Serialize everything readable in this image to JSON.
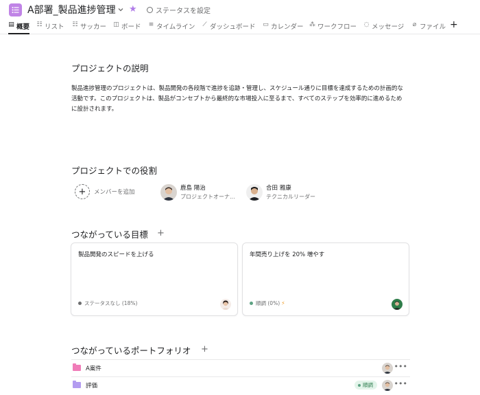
{
  "header": {
    "title": "A部署_製品進捗管理",
    "status_label": "ステータスを設定"
  },
  "tabs": [
    {
      "label": "概要",
      "icon": "clipboard-icon",
      "active": true
    },
    {
      "label": "リスト",
      "icon": "list-icon"
    },
    {
      "label": "サッカー",
      "icon": "list-icon"
    },
    {
      "label": "ボード",
      "icon": "board-icon"
    },
    {
      "label": "タイムライン",
      "icon": "timeline-icon"
    },
    {
      "label": "ダッシュボード",
      "icon": "dashboard-icon"
    },
    {
      "label": "カレンダー",
      "icon": "calendar-icon"
    },
    {
      "label": "ワークフロー",
      "icon": "workflow-icon"
    },
    {
      "label": "メッセージ",
      "icon": "message-icon"
    },
    {
      "label": "ファイル",
      "icon": "paperclip-icon"
    }
  ],
  "description": {
    "heading": "プロジェクトの説明",
    "text": "製品進捗管理のプロジェクトは、製品開発の各段階で進捗を追跡・管理し、スケジュール通りに目標を達成するための計画的な活動です。このプロジェクトは、製品がコンセプトから最終的な市場投入に至るまで、すべてのステップを効率的に進めるために設計されます。"
  },
  "roles": {
    "heading": "プロジェクトでの役割",
    "add_member_label": "メンバーを追加",
    "members": [
      {
        "name": "鹿島 陽治",
        "role": "プロジェクトオーナ..."
      },
      {
        "name": "合田 雅康",
        "role": "テクニカルリーダー"
      }
    ]
  },
  "goals": {
    "heading": "つながっている目標",
    "items": [
      {
        "title": "製品開発のスピードを上げる",
        "status": "ステータスなし (18%)",
        "status_color": "#6d6e6f"
      },
      {
        "title": "年間売り上げを 20% 増やす",
        "status": "順調 (0%)",
        "status_color": "#5da283"
      }
    ]
  },
  "portfolios": {
    "heading": "つながっているポートフォリオ",
    "items": [
      {
        "name": "A案件",
        "folder_color": "#f07cb8",
        "badge": ""
      },
      {
        "name": "評価",
        "folder_color": "#b39cf0",
        "badge": "順調"
      }
    ]
  },
  "colors": {
    "accent": "#c084e6",
    "on_track": "#5da283"
  }
}
